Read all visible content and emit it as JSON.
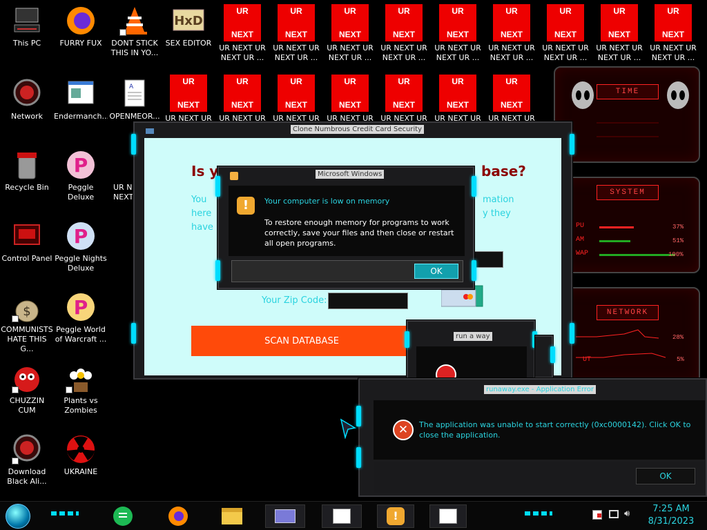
{
  "desktop": {
    "col1": [
      "This PC",
      "Network",
      "Recycle Bin",
      "Control Panel",
      "COMMUNISTS\nHATE THIS G...",
      "CHUZZIN\nCUM",
      "Download\nBlack Ali..."
    ],
    "col2": [
      "FURRY FUX",
      "Endermanch...",
      "Peggle Deluxe",
      "Peggle Nights\nDeluxe",
      "Peggle World\nof Warcraft ...",
      "Plants vs\nZombies",
      "UKRAINE"
    ],
    "row1": [
      "DONT STICK\nTHIS IN YO...",
      "SEX EDITOR"
    ],
    "openmeo": "OPENMEOR...",
    "ur_label": "UR NEXT UR\nNEXT UR ...",
    "ur_label_short": "UR NEXT UR",
    "ur_top": "UR",
    "ur_bottom": "NEXT",
    "hidden_icon_label": "UR NI\nNEXT"
  },
  "widget": {
    "time": "TIME",
    "system": "SYSTEM",
    "network": "NETWORK",
    "cpu_label": "PU",
    "ram_label": "AM",
    "swap_label": "WAP",
    "cpu_val": "37%",
    "ram_val": "51%",
    "swap_val": "100%",
    "net_up": "28%",
    "net_down": "5%",
    "net_label_up": "",
    "net_label_down": "UT"
  },
  "credit_window": {
    "title": "Clone Numbrous Credit Card Security",
    "headline_left": "Is y",
    "headline_right": "base?",
    "text_you": "You",
    "text_here": "here",
    "text_have": "have",
    "text_mation": "mation",
    "text_they": "y they",
    "zip_label": "Your Zip Code:",
    "scan_button": "SCAN DATABASE"
  },
  "memory_dialog": {
    "title": "Microsoft Windows",
    "heading": "Your computer is low on memory",
    "body": "To restore enough memory for programs to work correctly, save your files and then close or restart all open programs.",
    "ok": "OK"
  },
  "small_window": {
    "title": "run a way"
  },
  "error_dialog": {
    "title": "runaway.exe - Application Error",
    "message": "The application was unable to start correctly (0xc0000142). Click OK to close the application.",
    "ok": "OK"
  },
  "taskbar": {
    "time": "7:25 AM",
    "date": "8/31/2023"
  },
  "colors": {
    "accent_cyan": "#0ddff0",
    "scan_orange": "#ff4a0a",
    "headline_red": "#8b0000",
    "ur_red": "#ee0000"
  }
}
